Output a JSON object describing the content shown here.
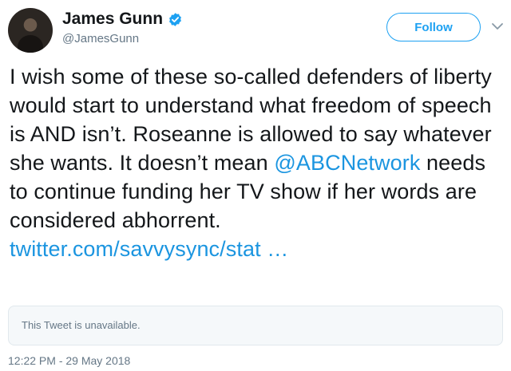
{
  "author": {
    "display_name": "James Gunn",
    "handle": "@JamesGunn",
    "verified": true
  },
  "actions": {
    "follow_label": "Follow"
  },
  "tweet": {
    "text_before_mention": "I wish some of these so-called defenders of liberty would start to understand what freedom of speech is AND isn’t. Roseanne is allowed to say whatever she wants. It doesn’t mean ",
    "mention": "@ABCNetwork",
    "text_after_mention": " needs to continue funding her TV show if her words are considered abhorrent.",
    "link": "twitter.com/savvysync/stat …"
  },
  "quoted_tweet": {
    "message": "This Tweet is unavailable."
  },
  "timestamp": "12:22 PM - 29 May 2018",
  "colors": {
    "accent": "#1da1f2",
    "link": "#1b95e0",
    "secondary_text": "#657786",
    "border": "#e1e8ed"
  }
}
